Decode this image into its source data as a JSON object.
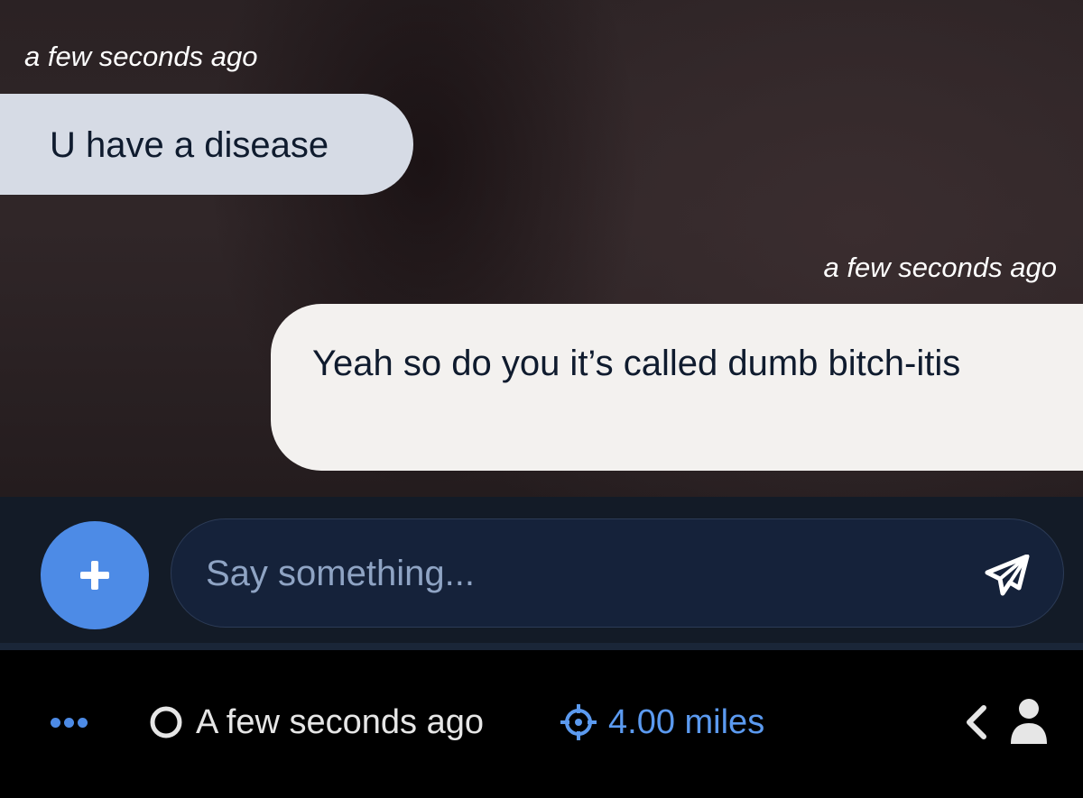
{
  "messages": [
    {
      "side": "received",
      "timestamp": "a few seconds ago",
      "text": "U have a disease"
    },
    {
      "side": "sent",
      "timestamp": "a few seconds ago",
      "text": "Yeah so do you it’s called dumb bitch-itis"
    }
  ],
  "composer": {
    "add_icon": "plus-icon",
    "placeholder": "Say something...",
    "send_icon": "paper-plane-icon"
  },
  "status_bar": {
    "more_icon": "ellipsis-icon",
    "last_seen_icon": "circle-outline-icon",
    "last_seen": "A few seconds ago",
    "distance_icon": "crosshair-icon",
    "distance": "4.00 miles",
    "back_icon": "chevron-left-icon",
    "profile_icon": "user-icon"
  },
  "colors": {
    "accent": "#4d8be6",
    "received_bubble": "#d6dbe5",
    "sent_bubble": "#f3f1ef",
    "composer_bg": "#131b27",
    "input_bg": "#15223a",
    "distance_text": "#5b9af0"
  }
}
